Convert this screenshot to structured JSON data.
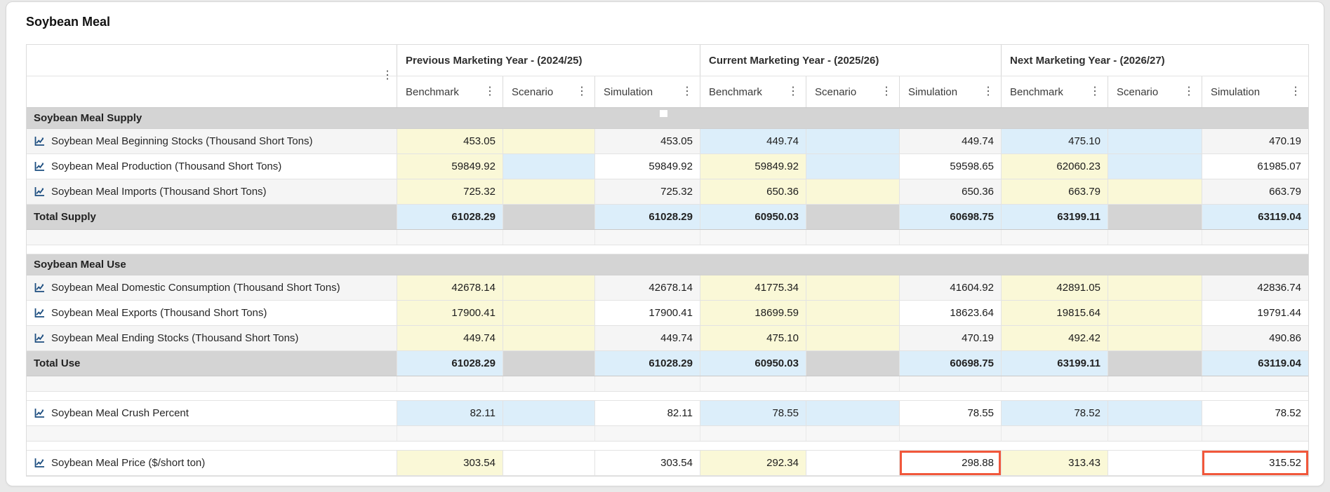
{
  "page_title": "Soybean Meal",
  "icons": {
    "kebab_icon": "⋮",
    "row_chart_icon": "line-chart"
  },
  "colors": {
    "input_cell": "#faf8d7",
    "calculated_cell": "#dceefa",
    "section_bg": "#d4d4d4",
    "highlight_border": "#f1573b",
    "chart_icon": "#1d4e80"
  },
  "table": {
    "year_groups": [
      "Previous Marketing Year - (2024/25)",
      "Current Marketing Year - (2025/26)",
      "Next Marketing Year - (2026/27)"
    ],
    "series": [
      "Benchmark",
      "Scenario",
      "Simulation"
    ],
    "rows": [
      {
        "type": "section",
        "label": "Soybean Meal Supply",
        "handle": true
      },
      {
        "type": "data",
        "striped": true,
        "label": "Soybean Meal Beginning Stocks (Thousand Short Tons)",
        "cells": [
          {
            "v": "453.05",
            "bg": "yellow"
          },
          {
            "v": "",
            "bg": "yellow"
          },
          {
            "v": "453.05",
            "bg": "stripe"
          },
          {
            "v": "449.74",
            "bg": "blue"
          },
          {
            "v": "",
            "bg": "blue"
          },
          {
            "v": "449.74",
            "bg": "stripe"
          },
          {
            "v": "475.10",
            "bg": "blue"
          },
          {
            "v": "",
            "bg": "blue"
          },
          {
            "v": "470.19",
            "bg": "stripe"
          }
        ]
      },
      {
        "type": "data",
        "striped": false,
        "label": "Soybean Meal Production (Thousand Short Tons)",
        "cells": [
          {
            "v": "59849.92",
            "bg": "yellow"
          },
          {
            "v": "",
            "bg": "blue"
          },
          {
            "v": "59849.92",
            "bg": "white"
          },
          {
            "v": "59849.92",
            "bg": "yellow"
          },
          {
            "v": "",
            "bg": "blue"
          },
          {
            "v": "59598.65",
            "bg": "white"
          },
          {
            "v": "62060.23",
            "bg": "yellow"
          },
          {
            "v": "",
            "bg": "blue"
          },
          {
            "v": "61985.07",
            "bg": "white"
          }
        ]
      },
      {
        "type": "data",
        "striped": true,
        "label": "Soybean Meal Imports (Thousand Short Tons)",
        "cells": [
          {
            "v": "725.32",
            "bg": "yellow"
          },
          {
            "v": "",
            "bg": "yellow"
          },
          {
            "v": "725.32",
            "bg": "stripe"
          },
          {
            "v": "650.36",
            "bg": "yellow"
          },
          {
            "v": "",
            "bg": "yellow"
          },
          {
            "v": "650.36",
            "bg": "stripe"
          },
          {
            "v": "663.79",
            "bg": "yellow"
          },
          {
            "v": "",
            "bg": "yellow"
          },
          {
            "v": "663.79",
            "bg": "stripe"
          }
        ]
      },
      {
        "type": "total",
        "label": "Total Supply",
        "cells": [
          {
            "v": "61028.29",
            "bg": "blue"
          },
          {
            "v": "",
            "bg": "gray"
          },
          {
            "v": "61028.29",
            "bg": "blue"
          },
          {
            "v": "60950.03",
            "bg": "blue"
          },
          {
            "v": "",
            "bg": "gray"
          },
          {
            "v": "60698.75",
            "bg": "blue"
          },
          {
            "v": "63199.11",
            "bg": "blue"
          },
          {
            "v": "",
            "bg": "gray"
          },
          {
            "v": "63119.04",
            "bg": "blue"
          }
        ]
      },
      {
        "type": "spacer"
      },
      {
        "type": "section",
        "label": "Soybean Meal Use",
        "handle": false
      },
      {
        "type": "data",
        "striped": true,
        "label": "Soybean Meal Domestic Consumption (Thousand Short Tons)",
        "cells": [
          {
            "v": "42678.14",
            "bg": "yellow"
          },
          {
            "v": "",
            "bg": "yellow"
          },
          {
            "v": "42678.14",
            "bg": "stripe"
          },
          {
            "v": "41775.34",
            "bg": "yellow"
          },
          {
            "v": "",
            "bg": "yellow"
          },
          {
            "v": "41604.92",
            "bg": "stripe"
          },
          {
            "v": "42891.05",
            "bg": "yellow"
          },
          {
            "v": "",
            "bg": "yellow"
          },
          {
            "v": "42836.74",
            "bg": "stripe"
          }
        ]
      },
      {
        "type": "data",
        "striped": false,
        "label": "Soybean Meal Exports (Thousand Short Tons)",
        "cells": [
          {
            "v": "17900.41",
            "bg": "yellow"
          },
          {
            "v": "",
            "bg": "yellow"
          },
          {
            "v": "17900.41",
            "bg": "white"
          },
          {
            "v": "18699.59",
            "bg": "yellow"
          },
          {
            "v": "",
            "bg": "yellow"
          },
          {
            "v": "18623.64",
            "bg": "white"
          },
          {
            "v": "19815.64",
            "bg": "yellow"
          },
          {
            "v": "",
            "bg": "yellow"
          },
          {
            "v": "19791.44",
            "bg": "white"
          }
        ]
      },
      {
        "type": "data",
        "striped": true,
        "label": "Soybean Meal Ending Stocks (Thousand Short Tons)",
        "cells": [
          {
            "v": "449.74",
            "bg": "yellow"
          },
          {
            "v": "",
            "bg": "yellow"
          },
          {
            "v": "449.74",
            "bg": "stripe"
          },
          {
            "v": "475.10",
            "bg": "yellow"
          },
          {
            "v": "",
            "bg": "yellow"
          },
          {
            "v": "470.19",
            "bg": "stripe"
          },
          {
            "v": "492.42",
            "bg": "yellow"
          },
          {
            "v": "",
            "bg": "yellow"
          },
          {
            "v": "490.86",
            "bg": "stripe"
          }
        ]
      },
      {
        "type": "total",
        "label": "Total Use",
        "cells": [
          {
            "v": "61028.29",
            "bg": "blue"
          },
          {
            "v": "",
            "bg": "gray"
          },
          {
            "v": "61028.29",
            "bg": "blue"
          },
          {
            "v": "60950.03",
            "bg": "blue"
          },
          {
            "v": "",
            "bg": "gray"
          },
          {
            "v": "60698.75",
            "bg": "blue"
          },
          {
            "v": "63199.11",
            "bg": "blue"
          },
          {
            "v": "",
            "bg": "gray"
          },
          {
            "v": "63119.04",
            "bg": "blue"
          }
        ]
      },
      {
        "type": "spacer"
      },
      {
        "type": "data",
        "striped": false,
        "label": "Soybean Meal Crush Percent",
        "cells": [
          {
            "v": "82.11",
            "bg": "blue"
          },
          {
            "v": "",
            "bg": "blue"
          },
          {
            "v": "82.11",
            "bg": "white"
          },
          {
            "v": "78.55",
            "bg": "blue"
          },
          {
            "v": "",
            "bg": "blue"
          },
          {
            "v": "78.55",
            "bg": "white"
          },
          {
            "v": "78.52",
            "bg": "blue"
          },
          {
            "v": "",
            "bg": "blue"
          },
          {
            "v": "78.52",
            "bg": "white"
          }
        ]
      },
      {
        "type": "spacer"
      },
      {
        "type": "data",
        "striped": false,
        "label": "Soybean Meal Price ($/short ton)",
        "cells": [
          {
            "v": "303.54",
            "bg": "yellow"
          },
          {
            "v": "",
            "bg": "white"
          },
          {
            "v": "303.54",
            "bg": "white"
          },
          {
            "v": "292.34",
            "bg": "yellow"
          },
          {
            "v": "",
            "bg": "white"
          },
          {
            "v": "298.88",
            "bg": "white",
            "highlight": true
          },
          {
            "v": "313.43",
            "bg": "yellow"
          },
          {
            "v": "",
            "bg": "white"
          },
          {
            "v": "315.52",
            "bg": "white",
            "highlight": true
          }
        ]
      }
    ]
  }
}
